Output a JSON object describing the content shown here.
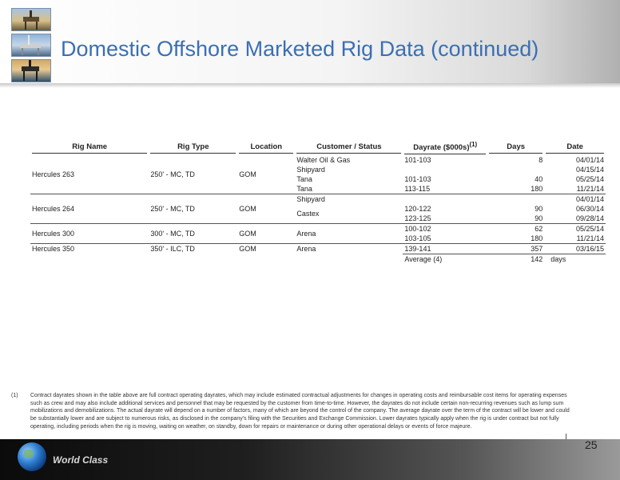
{
  "title": "Domestic Offshore Marketed Rig Data (continued)",
  "table": {
    "headers": {
      "rig_name": "Rig Name",
      "rig_type": "Rig Type",
      "location": "Location",
      "customer": "Customer / Status",
      "dayrate": "Dayrate ($000s)",
      "dayrate_sup": "(1)",
      "days": "Days",
      "date": "Date"
    },
    "rigs": [
      {
        "name": "Hercules 263",
        "type": "250' - MC, TD",
        "location": "GOM",
        "contracts": [
          {
            "customer": "Walter Oil & Gas",
            "dayrate": "101-103",
            "days": "8",
            "date": "04/01/14"
          },
          {
            "customer": "Shipyard",
            "dayrate": "",
            "days": "",
            "date": "04/15/14"
          },
          {
            "customer": "Tana",
            "dayrate": "101-103",
            "days": "40",
            "date": "05/25/14"
          },
          {
            "customer": "Tana",
            "dayrate": "113-115",
            "days": "180",
            "date": "11/21/14"
          }
        ]
      },
      {
        "name": "Hercules 264",
        "type": "250' - MC, TD",
        "location": "GOM",
        "contracts": [
          {
            "customer": "Shipyard",
            "dayrate": "",
            "days": "",
            "date": "04/01/14"
          },
          {
            "customer": "Castex",
            "dayrate": "120-122",
            "days": "90",
            "date": "06/30/14"
          },
          {
            "customer": "",
            "dayrate": "123-125",
            "days": "90",
            "date": "09/28/14"
          }
        ]
      },
      {
        "name": "Hercules 300",
        "type": "300' - MC, TD",
        "location": "GOM",
        "contracts": [
          {
            "customer": "Arena",
            "dayrate": "100-102",
            "days": "62",
            "date": "05/25/14"
          },
          {
            "customer": "",
            "dayrate": "103-105",
            "days": "180",
            "date": "11/21/14"
          }
        ]
      },
      {
        "name": "Hercules 350",
        "type": "350' - ILC, TD",
        "location": "GOM",
        "contracts": [
          {
            "customer": "Arena",
            "dayrate": "139-141",
            "days": "357",
            "date": "03/16/15"
          }
        ]
      }
    ],
    "average": {
      "label": "Average (4)",
      "days": "142",
      "unit": "days"
    }
  },
  "footnote": {
    "marker": "(1)",
    "text": "Contract dayrates shown in the table above are full contract operating dayrates, which may include estimated contractual adjustments for changes in operating costs and reimbursable cost items for operating expenses such as crew and may also include additional services and personnel that may be requested by the customer from time-to-time. However, the dayrates do not include certain non-recurring revenues such as lump sum mobilizations and demobilizations. The actual dayrate will depend on a number of factors, many of which are beyond the control of the company. The average dayrate over the term of the contract will be lower and could be substantially lower and are subject to numerous risks, as disclosed in the company's filing with the Securities and Exchange Commission. Lower dayrates typically apply when the rig is under contract but not fully operating, including periods when the rig is moving, waiting on weather, on standby, down for repairs or maintenance or during other operational delays or events of force majeure."
  },
  "footer": {
    "tagline": "World Class",
    "page_number": "25"
  },
  "colors": {
    "title": "#3a6fb3",
    "footer_bar": "#1f1f1f"
  },
  "icons": [
    "offshore-rig-photo",
    "globe-icon"
  ]
}
